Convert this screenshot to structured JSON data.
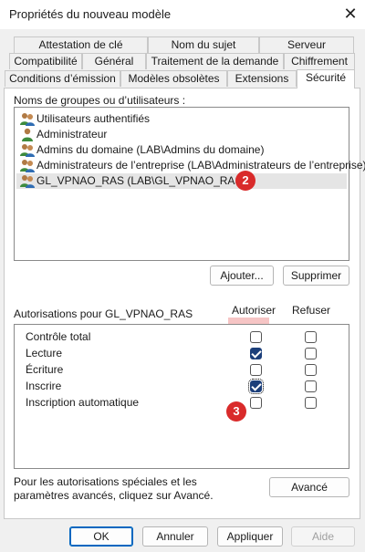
{
  "window": {
    "title": "Propriétés du nouveau modèle",
    "close_glyph": "✕"
  },
  "tabs": {
    "row1": [
      "Attestation de clé",
      "Nom du sujet",
      "Serveur"
    ],
    "row2": [
      "Compatibilité",
      "Général",
      "Traitement de la demande",
      "Chiffrement"
    ],
    "row3": [
      "Conditions d’émission",
      "Modèles obsolètes",
      "Extensions",
      "Sécurité"
    ],
    "active": "Sécurité"
  },
  "users_section": {
    "label": "Noms de groupes ou d’utilisateurs :",
    "items": [
      {
        "name": "Utilisateurs authentifiés",
        "icon": "group-users-icon"
      },
      {
        "name": "Administrateur",
        "icon": "user-icon"
      },
      {
        "name": "Admins du domaine (LAB\\Admins du domaine)",
        "icon": "group-users-icon"
      },
      {
        "name": "Administrateurs de l’entreprise (LAB\\Administrateurs de l’entreprise)",
        "icon": "group-users-icon"
      },
      {
        "name": "GL_VPNAO_RAS (LAB\\GL_VPNAO_RAS)",
        "icon": "group-users-icon"
      }
    ],
    "selected_index": 4,
    "add_button": "Ajouter...",
    "remove_button": "Supprimer"
  },
  "permissions": {
    "label": "Autorisations pour GL_VPNAO_RAS",
    "allow_header": "Autoriser",
    "deny_header": "Refuser",
    "rows": [
      {
        "name": "Contrôle total",
        "allow": false,
        "deny": false
      },
      {
        "name": "Lecture",
        "allow": true,
        "deny": false
      },
      {
        "name": "Écriture",
        "allow": false,
        "deny": false
      },
      {
        "name": "Inscrire",
        "allow": true,
        "deny": false
      },
      {
        "name": "Inscription automatique",
        "allow": false,
        "deny": false
      }
    ]
  },
  "advanced": {
    "text": "Pour les autorisations spéciales et les paramètres avancés, cliquez sur Avancé.",
    "button": "Avancé"
  },
  "footer": {
    "ok": "OK",
    "cancel": "Annuler",
    "apply": "Appliquer",
    "help": "Aide"
  },
  "annotations": {
    "badge_user": "2",
    "badge_allow": "3",
    "badge_color": "#d92b2b",
    "highlight_color": "#e55a5a"
  }
}
